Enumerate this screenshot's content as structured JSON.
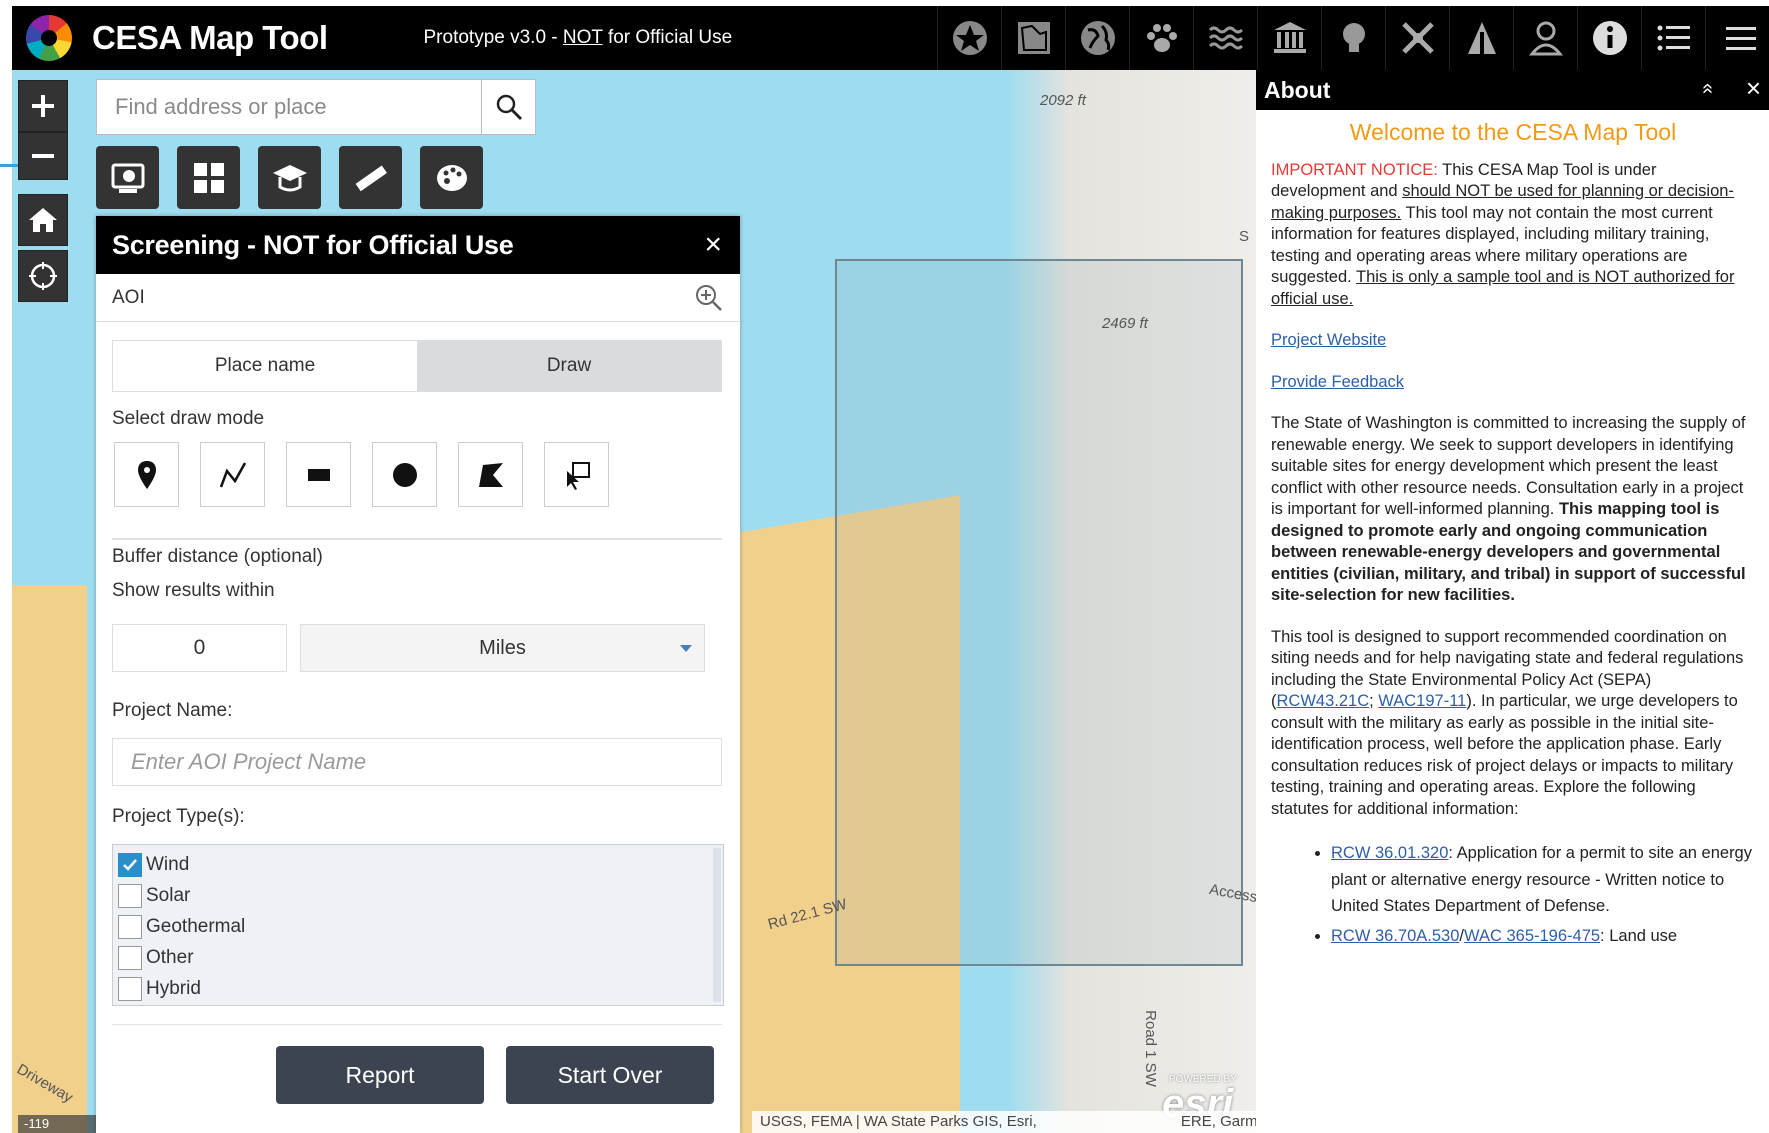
{
  "header": {
    "title": "CESA Map Tool",
    "subtitle_prefix": "Prototype v3.0 - ",
    "subtitle_not": "NOT",
    "subtitle_suffix": " for Official Use",
    "icons": [
      "star-icon",
      "layers-icon",
      "globe-icon",
      "paw-icon",
      "water-icon",
      "building-icon",
      "lightbulb-icon",
      "military-icon",
      "tower-icon",
      "user-icon",
      "info-icon",
      "list-icon",
      "menu-icon"
    ]
  },
  "search": {
    "placeholder": "Find address or place"
  },
  "map": {
    "elev1": "2092 ft",
    "elev2": "2469 ft",
    "road1": "Rd 22.1 SW",
    "road2": "Road 1 SW",
    "access": "Access",
    "driveway": "Driveway",
    "s_label": "S",
    "coord": "-119",
    "attribution_left": "USGS, FEMA | WA State Parks GIS, Esri,",
    "attribution_right": "ERE, Garmin, FAO, NOAA, USGS, Bure",
    "powered": "POWERED BY",
    "esri": "esri"
  },
  "panel": {
    "title": "Screening - NOT for Official Use",
    "close": "×",
    "aoi": "AOI",
    "tab_place": "Place name",
    "tab_draw": "Draw",
    "draw_mode_label": "Select draw mode",
    "buffer_label": "Buffer distance (optional)",
    "show_label": "Show results within",
    "buffer_value": "0",
    "buffer_unit": "Miles",
    "project_name_label": "Project Name:",
    "project_name_placeholder": "Enter AOI Project Name",
    "project_types_label": "Project Type(s):",
    "types": [
      {
        "label": "Wind",
        "checked": true
      },
      {
        "label": "Solar",
        "checked": false
      },
      {
        "label": "Geothermal",
        "checked": false
      },
      {
        "label": "Other",
        "checked": false
      },
      {
        "label": "Hybrid",
        "checked": false
      }
    ],
    "report": "Report",
    "start_over": "Start Over"
  },
  "about": {
    "title": "About",
    "collapse": "«",
    "close": "×",
    "welcome": "Welcome to the CESA Map Tool",
    "notice_label": "IMPORTANT NOTICE:",
    "notice_1": " This CESA Map Tool is under development and ",
    "notice_u1": "should NOT be used for planning or decision-making purposes.",
    "notice_2": " This tool may not contain the most current information for features displayed, including military training, testing and operating areas where military operations are suggested. ",
    "notice_u2": "This is only a sample tool and is NOT authorized for official use.",
    "link_website": "Project Website",
    "link_feedback": "Provide Feedback",
    "para1_normal": "The State of Washington is committed to increasing the supply of renewable energy. We seek to support developers in identifying suitable sites for energy development which present the least conflict with other resource needs. Consultation early in a project is important for well-informed planning. ",
    "para1_bold": "This mapping tool is designed to promote early and ongoing communication between renewable-energy developers and governmental entities (civilian, military, and tribal) in support of successful site-selection for new facilities.",
    "para2_a": "This tool is designed to support recommended coordination on siting needs and for help navigating state and federal regulations including the State Environmental Policy Act (SEPA) (",
    "para2_link1": "RCW43.21C",
    "para2_sep": "; ",
    "para2_link2": "WAC197-11",
    "para2_b": "). In particular, we urge developers to consult with the military as early as possible in the initial site-identification process, well before the application phase. Early consultation reduces risk of project delays or impacts to military testing, training and operating areas. Explore the following statutes for additional information:",
    "li1_link": "RCW 36.01.320",
    "li1_text": ": Application for a permit to site an energy plant or alternative energy resource - Written notice to United States Department of Defense.",
    "li2_link1": "RCW 36.70A.530",
    "li2_sep": "/",
    "li2_link2": "WAC 365-196-475",
    "li2_text": ": Land use"
  }
}
